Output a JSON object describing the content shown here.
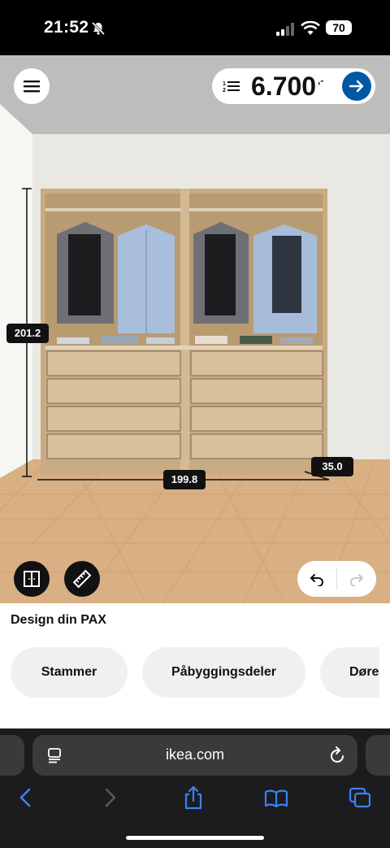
{
  "status_bar": {
    "time": "21:52",
    "battery": "70"
  },
  "header": {
    "price": "6.700",
    "price_suffix": ",-"
  },
  "dimensions": {
    "height": "201.2",
    "width": "199.8",
    "depth": "35.0"
  },
  "panel": {
    "title": "Design din PAX",
    "categories": [
      "Stammer",
      "Påbyggingsdeler",
      "Døre"
    ]
  },
  "browser": {
    "url": "ikea.com"
  },
  "icons": {
    "menu": "hamburger-menu-icon",
    "list": "numbered-list-icon",
    "go": "arrow-right-icon",
    "frame": "wardrobe-frame-icon",
    "measure": "ruler-icon",
    "undo": "undo-icon",
    "redo": "redo-icon"
  },
  "colors": {
    "accent": "#0058a3",
    "dark": "#111111"
  }
}
